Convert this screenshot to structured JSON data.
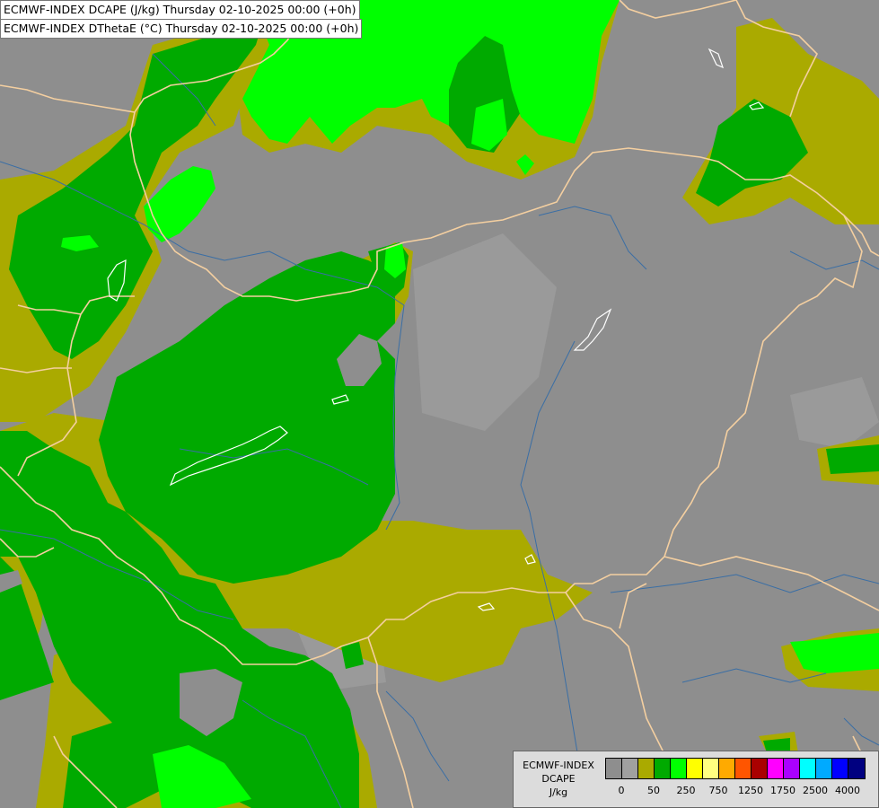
{
  "header": {
    "title1": "ECMWF-INDEX DCAPE (J/kg) Thursday 02-10-2025 00:00 (+0h)",
    "title2": "ECMWF-INDEX DThetaE (°C) Thursday 02-10-2025 00:00 (+0h)"
  },
  "legend": {
    "label_line1": "ECMWF-INDEX",
    "label_line2": "DCAPE",
    "label_line3": "J/kg",
    "colors": [
      "#8e8e8e",
      "#a0a0a0",
      "#aaaa00",
      "#00aa00",
      "#00ff00",
      "#ffff00",
      "#ffff80",
      "#ffaa00",
      "#ff5500",
      "#aa0000",
      "#ff00ff",
      "#aa00ff",
      "#00ffff",
      "#00aaff",
      "#0000ff",
      "#000080"
    ],
    "ticks": [
      {
        "label": "0",
        "index": 1
      },
      {
        "label": "50",
        "index": 3
      },
      {
        "label": "250",
        "index": 5
      },
      {
        "label": "750",
        "index": 7
      },
      {
        "label": "1250",
        "index": 9
      },
      {
        "label": "1750",
        "index": 11
      },
      {
        "label": "2500",
        "index": 13
      },
      {
        "label": "4000",
        "index": 15
      }
    ]
  },
  "map_colors": {
    "background": "#8e8e8e",
    "light_gray": "#a6a6a6",
    "olive": "#aaaa00",
    "green": "#00aa00",
    "bright_green": "#00ff00",
    "border_line": "#f4cfa0",
    "river_line": "#3a6ea5",
    "lake_outline": "#ffffff"
  }
}
